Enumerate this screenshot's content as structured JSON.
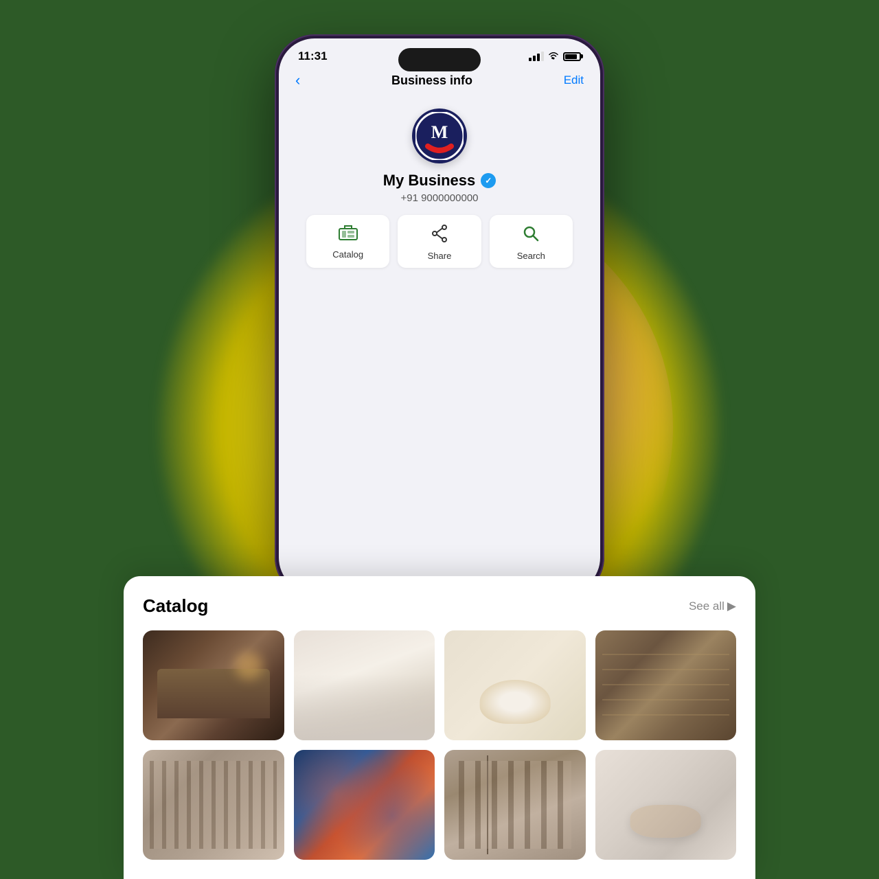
{
  "background": {
    "color": "#2d5a27"
  },
  "phone": {
    "statusBar": {
      "time": "11:31",
      "signal": "signal",
      "wifi": "wifi",
      "battery": "battery"
    },
    "navBar": {
      "backLabel": "‹",
      "title": "Business info",
      "editLabel": "Edit"
    },
    "profile": {
      "businessName": "My Business",
      "phone": "+91 9000000000",
      "verified": true,
      "verifiedIcon": "✓"
    },
    "actions": [
      {
        "id": "catalog",
        "label": "Catalog",
        "icon": "catalog"
      },
      {
        "id": "share",
        "label": "Share",
        "icon": "share"
      },
      {
        "id": "search",
        "label": "Search",
        "icon": "search"
      }
    ]
  },
  "catalog": {
    "title": "Catalog",
    "seeAllLabel": "See all",
    "seeAllIcon": "▶",
    "images": [
      {
        "id": "bedroom",
        "alt": "Bedroom",
        "type": "bedroom"
      },
      {
        "id": "bedsheet",
        "alt": "Bed sheet",
        "type": "bedsheet"
      },
      {
        "id": "tea-set",
        "alt": "Tea set",
        "type": "teaSet"
      },
      {
        "id": "shoes",
        "alt": "Shoes rack",
        "type": "shoes"
      },
      {
        "id": "clothes",
        "alt": "Clothes rack",
        "type": "clothes"
      },
      {
        "id": "ceramics",
        "alt": "Ceramics",
        "type": "ceramics"
      },
      {
        "id": "clothing-rack",
        "alt": "Clothing rack",
        "type": "rack"
      },
      {
        "id": "pillows",
        "alt": "Pillows bedding",
        "type": "pillow"
      }
    ]
  }
}
